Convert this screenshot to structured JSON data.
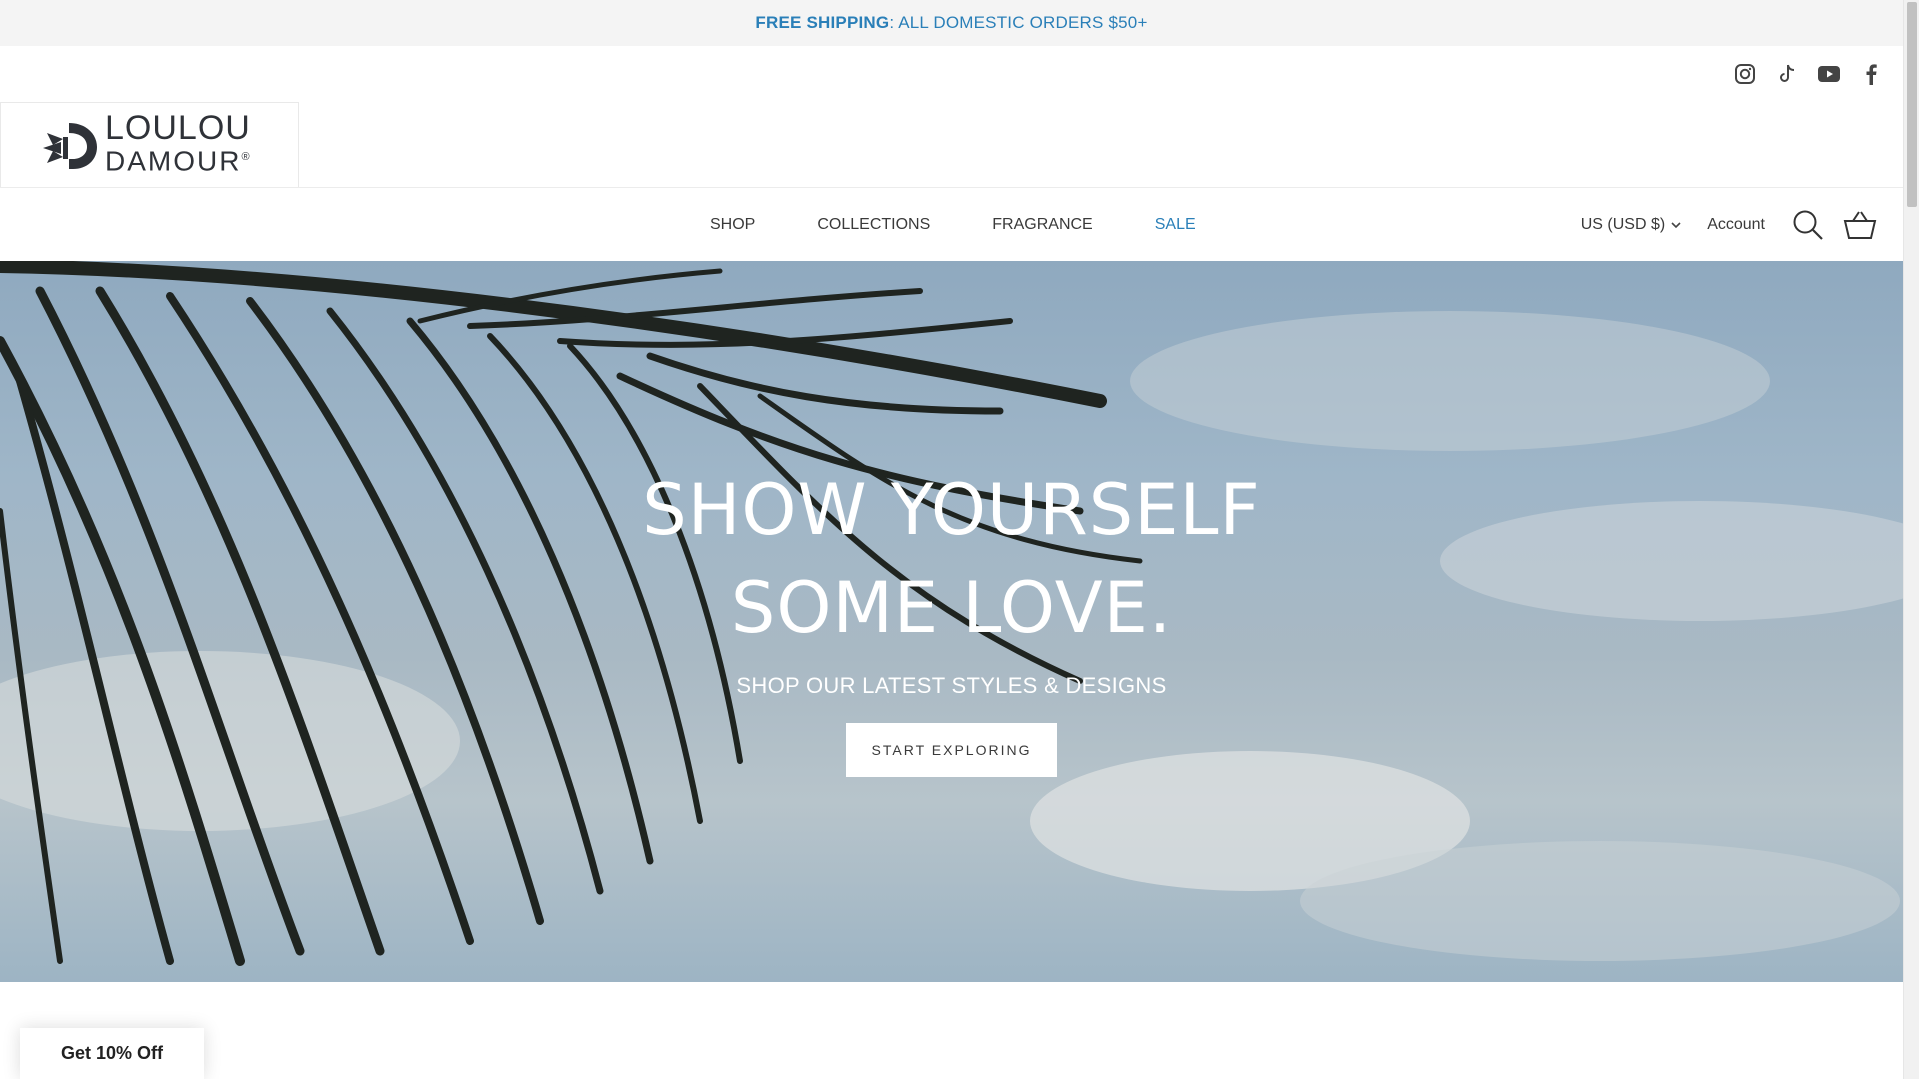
{
  "announcement": {
    "bold": "FREE SHIPPING",
    "rest": ": ALL DOMESTIC ORDERS $50+"
  },
  "social": [
    "instagram-icon",
    "tiktok-icon",
    "youtube-icon",
    "facebook-icon"
  ],
  "logo": {
    "line1": "LOULOU",
    "line2": "DAMOUR",
    "reg": "®"
  },
  "nav": {
    "shop": "SHOP",
    "collections": "COLLECTIONS",
    "fragrance": "FRAGRANCE",
    "sale": "SALE"
  },
  "header": {
    "currency": "US (USD $)",
    "account": "Account",
    "search_icon": "search-icon",
    "cart_icon": "basket-icon"
  },
  "hero": {
    "title_line1": "SHOW YOURSELF",
    "title_line2": "SOME LOVE.",
    "subtitle": "SHOP OUR LATEST STYLES & DESIGNS",
    "cta": "START EXPLORING"
  },
  "popup_tab": {
    "label": "Get 10% Off"
  },
  "colors": {
    "accent": "#2a7fb8",
    "announcement_bg": "#f4f4f4"
  }
}
